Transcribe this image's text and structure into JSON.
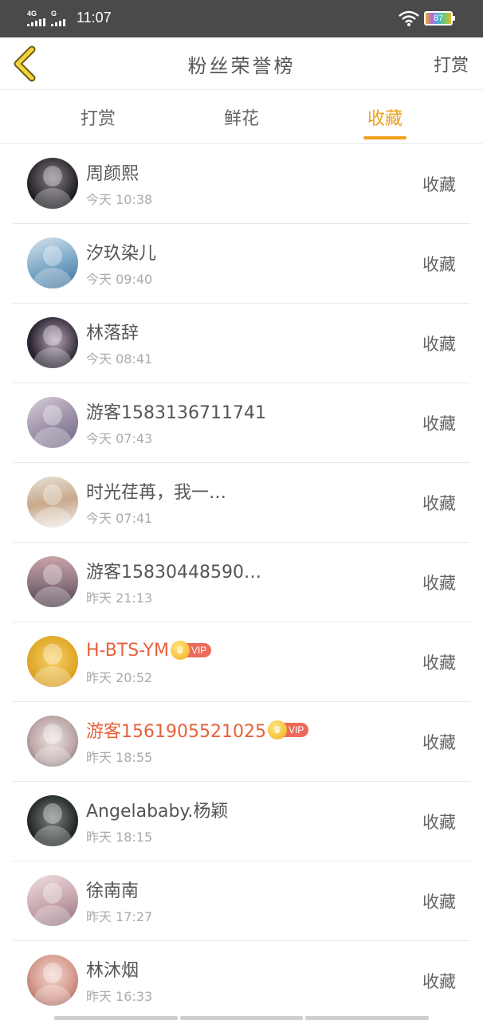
{
  "status_bar": {
    "net1": "4G",
    "net2": "G",
    "time": "11:07",
    "battery": "87"
  },
  "header": {
    "title": "粉丝荣誉榜",
    "action": "打赏",
    "back_icon": "chevron-left-icon"
  },
  "tabs": [
    {
      "label": "打赏",
      "active": false
    },
    {
      "label": "鲜花",
      "active": false
    },
    {
      "label": "收藏",
      "active": true
    }
  ],
  "colors": {
    "accent": "#f0a01e",
    "vip_name": "#e8613a",
    "vip_badge": "#ec6a5a",
    "status_bar": "#4a4a4a"
  },
  "items": [
    {
      "name": "周颜熙",
      "time": "今天 10:38",
      "action": "收藏",
      "vip": false
    },
    {
      "name": "汐玖染儿",
      "time": "今天 09:40",
      "action": "收藏",
      "vip": false
    },
    {
      "name": "林落辞",
      "time": "今天 08:41",
      "action": "收藏",
      "vip": false
    },
    {
      "name": "游客1583136711741",
      "time": "今天 07:43",
      "action": "收藏",
      "vip": false
    },
    {
      "name": "时光荏苒，我一…",
      "time": "今天 07:41",
      "action": "收藏",
      "vip": false
    },
    {
      "name": "游客15830448590…",
      "time": "昨天 21:13",
      "action": "收藏",
      "vip": false
    },
    {
      "name": "H-BTS-YM",
      "time": "昨天 20:52",
      "action": "收藏",
      "vip": true,
      "vip_label": "VIP"
    },
    {
      "name": "游客1561905521025",
      "time": "昨天 18:55",
      "action": "收藏",
      "vip": true,
      "vip_label": "VIP"
    },
    {
      "name": "Angelababy.杨颖",
      "time": "昨天 18:15",
      "action": "收藏",
      "vip": false
    },
    {
      "name": "徐南南",
      "time": "昨天 17:27",
      "action": "收藏",
      "vip": false
    },
    {
      "name": "林沐烟",
      "time": "昨天 16:33",
      "action": "收藏",
      "vip": false
    }
  ]
}
